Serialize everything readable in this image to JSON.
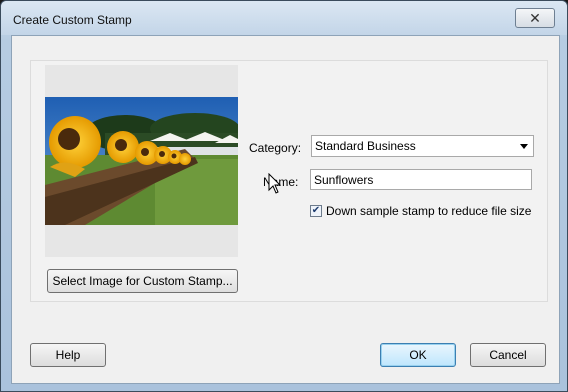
{
  "window": {
    "title": "Create Custom Stamp",
    "close_icon": "close-icon"
  },
  "preview": {
    "image": "sunflowers-photo"
  },
  "buttons": {
    "select_image": "Select Image for Custom Stamp...",
    "help": "Help",
    "ok": "OK",
    "cancel": "Cancel"
  },
  "form": {
    "category_label": "Category:",
    "category_value": "Standard Business",
    "name_label": "Name:",
    "name_value": "Sunflowers",
    "downsample_label": "Down sample stamp to reduce file size",
    "downsample_checked": true
  }
}
